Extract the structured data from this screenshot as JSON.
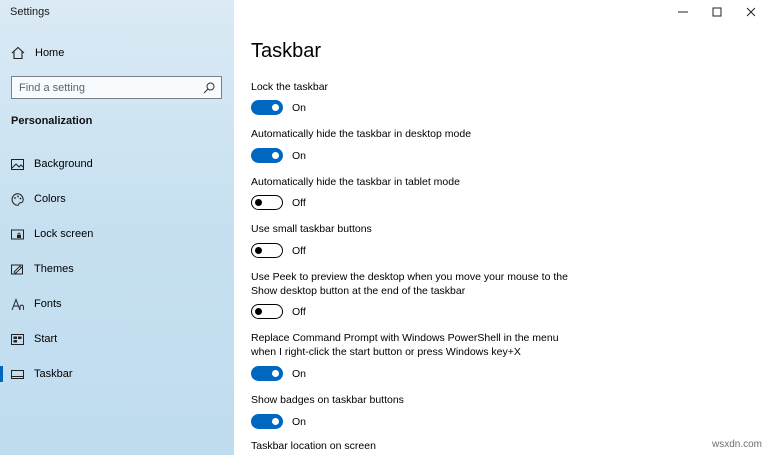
{
  "window": {
    "title": "Settings"
  },
  "sidebar": {
    "home_label": "Home",
    "search_placeholder": "Find a setting",
    "section_title": "Personalization",
    "items": [
      {
        "label": "Background",
        "icon": "image-icon"
      },
      {
        "label": "Colors",
        "icon": "palette-icon"
      },
      {
        "label": "Lock screen",
        "icon": "lock-screen-icon"
      },
      {
        "label": "Themes",
        "icon": "themes-icon"
      },
      {
        "label": "Fonts",
        "icon": "fonts-icon"
      },
      {
        "label": "Start",
        "icon": "start-icon"
      },
      {
        "label": "Taskbar",
        "icon": "taskbar-icon",
        "active": true
      }
    ]
  },
  "main": {
    "title": "Taskbar",
    "settings": [
      {
        "label": "Lock the taskbar",
        "state": "On",
        "on": true
      },
      {
        "label": "Automatically hide the taskbar in desktop mode",
        "state": "On",
        "on": true
      },
      {
        "label": "Automatically hide the taskbar in tablet mode",
        "state": "Off",
        "on": false
      },
      {
        "label": "Use small taskbar buttons",
        "state": "Off",
        "on": false
      },
      {
        "label": "Use Peek to preview the desktop when you move your mouse to the Show desktop button at the end of the taskbar",
        "state": "Off",
        "on": false
      },
      {
        "label": "Replace Command Prompt with Windows PowerShell in the menu when I right-click the start button or press Windows key+X",
        "state": "On",
        "on": true
      },
      {
        "label": "Show badges on taskbar buttons",
        "state": "On",
        "on": true
      }
    ],
    "next_label": "Taskbar location on screen"
  },
  "colors": {
    "accent": "#0067c0",
    "sidebar_bg": "#c8e1f1"
  },
  "watermark": "wsxdn.com"
}
